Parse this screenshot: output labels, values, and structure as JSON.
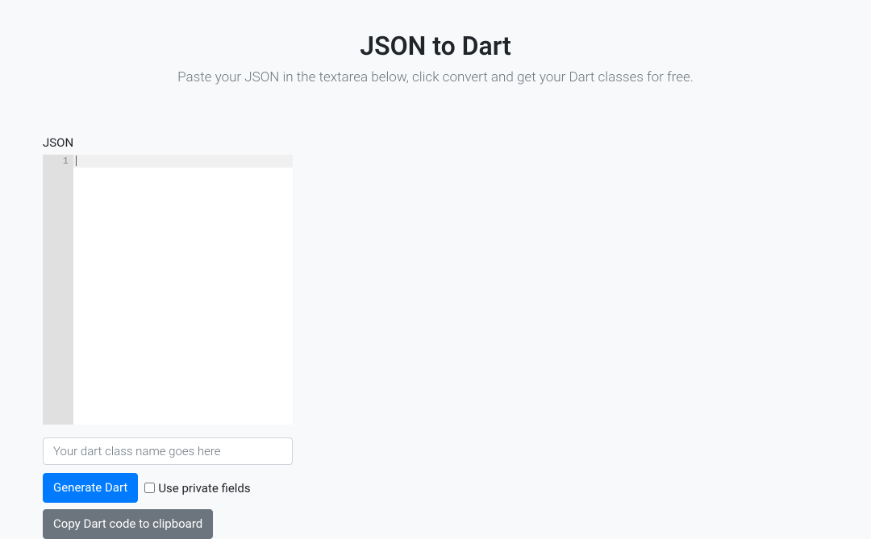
{
  "header": {
    "title": "JSON to Dart",
    "subtitle": "Paste your JSON in the textarea below, click convert and get your Dart classes for free."
  },
  "editor": {
    "label": "JSON",
    "line_number": "1",
    "content": ""
  },
  "form": {
    "classname_placeholder": "Your dart class name goes here",
    "classname_value": "",
    "generate_label": "Generate Dart",
    "private_fields_label": "Use private fields",
    "private_fields_checked": false,
    "copy_label": "Copy Dart code to clipboard"
  }
}
